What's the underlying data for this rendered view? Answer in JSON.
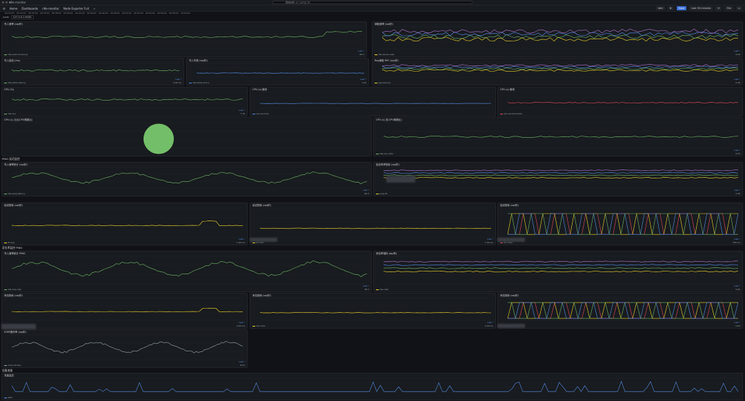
{
  "browser": {
    "tab_title": "n9e-monitor",
    "search_placeholder": "Search or jump to",
    "kbd": "ctrl+k"
  },
  "nav": {
    "home": "Home",
    "dashboards": "Dashboards",
    "folder": "n9e-monitor",
    "dashboard": "Node Exporter Full"
  },
  "toolbar": {
    "add": "Add",
    "save": "Save",
    "time": "Last 30 minutes",
    "refresh": "30s"
  },
  "variables": {
    "label": "node",
    "value": "127.0.0.1:9100"
  },
  "time_ticks": [
    "09:30:00",
    "09:32:00",
    "09:34:00",
    "09:36:00",
    "09:38:00",
    "09:40:00",
    "09:42:00",
    "09:44:00",
    "09:46:00",
    "09:48:00",
    "09:50:00",
    "09:52:00",
    "09:54:00",
    "09:56:00",
    "09:58:00",
    "10:00:00"
  ],
  "rows": {
    "r1": "PING 延迟监控",
    "r2": "丢包率监控 PING",
    "r3": "设备流量"
  },
  "panels": [
    {
      "id": "p1",
      "title": "写入速率 (op/秒)",
      "legend": "n9e-push-receiving",
      "lhead": "Last *",
      "lval": "84.3",
      "color": "#73bf69",
      "n": 90,
      "base": 0.55,
      "amp": 0.08,
      "jump": 0.78,
      "type": "line"
    },
    {
      "id": "p2",
      "title": "读取速率 (op/秒)",
      "legend": "n9e-series-read",
      "lhead": "Last *",
      "lval": "9.94",
      "color": "#fade2a",
      "n": 90,
      "base": 0.45,
      "amp": 0.2,
      "type": "multi"
    },
    {
      "id": "p3",
      "title": "写入延迟 (ms)",
      "legend": "n9e-write-latency",
      "lhead": "Last *",
      "lval": "0.00 ms",
      "color": "#73bf69",
      "n": 70,
      "base": 0.5,
      "amp": 0.12,
      "type": "line"
    },
    {
      "id": "p4",
      "title": "写入失败 (op/秒)",
      "legend": "n9e-write-errors",
      "lhead": "Last *",
      "lval": "1.00",
      "color": "#5794f2",
      "n": 70,
      "base": 0.3,
      "amp": 0.03,
      "type": "line"
    },
    {
      "id": "p5",
      "title": "Rag读取 RPC (op/秒)",
      "legend": "rag-read-rpc",
      "lhead": "Last *",
      "lval": "0.48",
      "color": "#fade2a",
      "n": 90,
      "base": 0.5,
      "amp": 0.15,
      "type": "multi"
    },
    {
      "id": "p6",
      "title": "CPU (%)",
      "legend": "n9e-cpu",
      "lhead": "Last *",
      "lval": "7.78",
      "color": "#73bf69",
      "n": 80,
      "base": 0.55,
      "amp": 0.1,
      "type": "line"
    },
    {
      "id": "p7",
      "title": "CPU (s) 使用",
      "legend": "cpu-seconds",
      "lhead": "",
      "lval": "",
      "color": "#5794f2",
      "n": 60,
      "base": 0.3,
      "amp": 0.02,
      "type": "flat"
    },
    {
      "id": "p8",
      "title": "CPU (s) 使用",
      "legend": "cpu-seconds-total",
      "lhead": "",
      "lval": "",
      "color": "#f2495c",
      "n": 90,
      "base": 0.35,
      "amp": 0.05,
      "type": "line"
    },
    {
      "id": "p9",
      "title": "CPU (s) 占比(CPU核数比)",
      "legend": "",
      "lhead": "",
      "lval": "",
      "color": "#73bf69",
      "type": "gauge"
    },
    {
      "id": "p10",
      "title": "CPU (s) 总(CPU核数比)",
      "legend": "n9e-cpu-ratio",
      "lhead": "Last *",
      "lval": "0.03",
      "color": "#73bf69",
      "n": 80,
      "base": 0.45,
      "amp": 0.06,
      "type": "line"
    },
    {
      "id": "p11",
      "title": "写入速率统计 (op/秒)",
      "legend": "n9e-ping-latency",
      "lhead": "Last *",
      "lval": "66.3",
      "color": "#73bf69",
      "n": 120,
      "base": 0.5,
      "amp": 0.3,
      "type": "wave"
    },
    {
      "id": "p12",
      "title": "延迟采样指标 (op/秒)",
      "legend": "ping-rtt",
      "lhead": "Last *",
      "lval": "2.38",
      "color": "#fade2a",
      "n": 100,
      "base": 0.5,
      "amp": 0.05,
      "type": "multi"
    },
    {
      "id": "p13",
      "title": "延迟指标 (op/秒)",
      "legend": "rtt-avg",
      "lhead": "Last *",
      "lval": "1.00 ms",
      "color": "#fade2a",
      "n": 70,
      "base": 0.4,
      "amp": 0.02,
      "type": "flat"
    },
    {
      "id": "p14",
      "title": "延迟指标 (op/秒)",
      "legend": "rtt-max",
      "lhead": "Last *",
      "lval": "1.00 ms",
      "color": "#fade2a",
      "n": 70,
      "base": 0.3,
      "amp": 0.02,
      "type": "flat"
    },
    {
      "id": "p15",
      "title": "延迟指标 (op/秒)",
      "legend": "rtt-mdev",
      "lhead": "Last *",
      "lval": "790 ms",
      "color": "#f2495c",
      "n": 60,
      "base": 0.5,
      "amp": 0.4,
      "type": "square"
    },
    {
      "id": "p16",
      "title": "写入速率统计 PING",
      "legend": "n9e-loss-rate",
      "lhead": "Last *",
      "lval": "28.1",
      "color": "#73bf69",
      "n": 120,
      "base": 0.55,
      "amp": 0.3,
      "type": "wave"
    },
    {
      "id": "p17",
      "title": "丢包率指标 (op/秒)",
      "legend": "loss-rate",
      "lhead": "Last *",
      "lval": "0.00",
      "color": "#fade2a",
      "n": 100,
      "base": 0.45,
      "amp": 0.04,
      "type": "multi"
    },
    {
      "id": "p18",
      "title": "丢包指标 (op/秒)",
      "legend": "loss-avg",
      "lhead": "Last *",
      "lval": "0.00 ms",
      "color": "#fade2a",
      "n": 70,
      "base": 0.4,
      "amp": 0.02,
      "type": "flat"
    },
    {
      "id": "p19",
      "title": "丢包指标 (op/秒)",
      "legend": "loss-max",
      "lhead": "Last *",
      "lval": "0.00 ms",
      "color": "#fade2a",
      "n": 70,
      "base": 0.35,
      "amp": 0.02,
      "type": "flat"
    },
    {
      "id": "p20",
      "title": "丢包指标 (op/秒)",
      "legend": "loss-mdev",
      "lhead": "Last *",
      "lval": "0.00",
      "color": "#5794f2",
      "n": 60,
      "base": 0.5,
      "amp": 0.4,
      "type": "square"
    },
    {
      "id": "p21",
      "title": "ICMP重传率 (op/秒)",
      "legend": "icmp-retrans",
      "lhead": "Last *",
      "lval": "8.91",
      "color": "#9aa",
      "n": 110,
      "base": 0.5,
      "amp": 0.25,
      "type": "wave"
    },
    {
      "id": "p22",
      "title": "流量监控",
      "legend": "eth0",
      "lhead": "",
      "lval": "",
      "color": "#5794f2",
      "n": 200,
      "base": 0.2,
      "amp": 0.6,
      "type": "spikes"
    }
  ]
}
